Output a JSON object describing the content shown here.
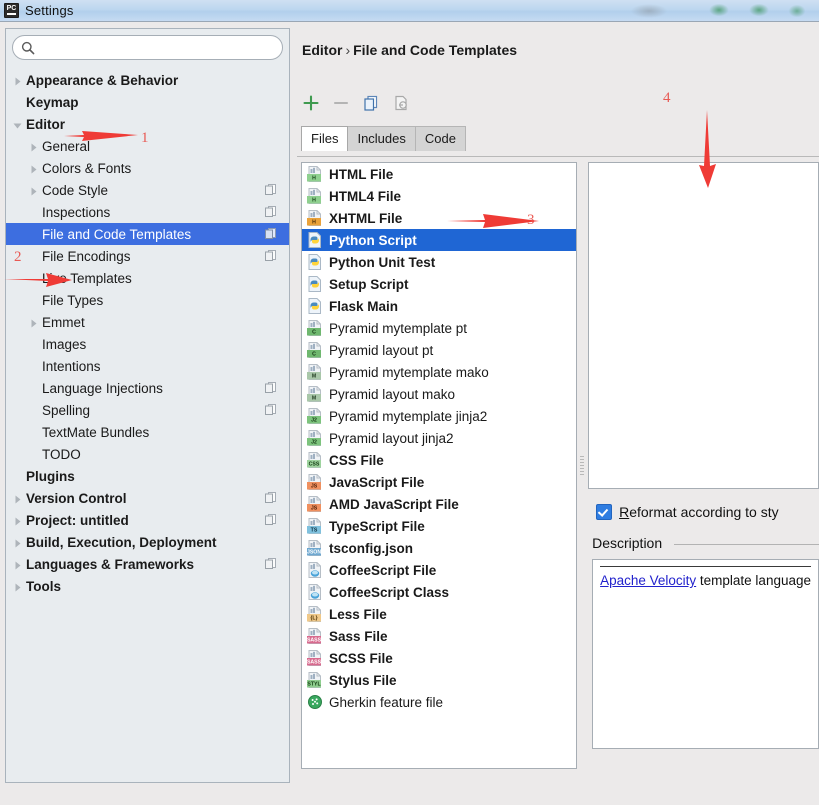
{
  "window": {
    "title": "Settings",
    "app_icon": "pycharm-icon"
  },
  "sidebar": {
    "search": {
      "value": "",
      "placeholder": "",
      "icon": "search-icon"
    },
    "items": [
      {
        "label": "Appearance & Behavior",
        "level": 0,
        "bold": true,
        "twisty": "collapsed",
        "scope_icon": false,
        "selected": false
      },
      {
        "label": "Keymap",
        "level": 0,
        "bold": true,
        "twisty": "none",
        "scope_icon": false,
        "selected": false
      },
      {
        "label": "Editor",
        "level": 0,
        "bold": true,
        "twisty": "expanded",
        "scope_icon": false,
        "selected": false
      },
      {
        "label": "General",
        "level": 1,
        "bold": false,
        "twisty": "collapsed",
        "scope_icon": false,
        "selected": false
      },
      {
        "label": "Colors & Fonts",
        "level": 1,
        "bold": false,
        "twisty": "collapsed",
        "scope_icon": false,
        "selected": false
      },
      {
        "label": "Code Style",
        "level": 1,
        "bold": false,
        "twisty": "collapsed",
        "scope_icon": true,
        "selected": false
      },
      {
        "label": "Inspections",
        "level": 1,
        "bold": false,
        "twisty": "none",
        "scope_icon": true,
        "selected": false
      },
      {
        "label": "File and Code Templates",
        "level": 1,
        "bold": false,
        "twisty": "none",
        "scope_icon": true,
        "selected": true
      },
      {
        "label": "File Encodings",
        "level": 1,
        "bold": false,
        "twisty": "none",
        "scope_icon": true,
        "selected": false
      },
      {
        "label": "Live Templates",
        "level": 1,
        "bold": false,
        "twisty": "none",
        "scope_icon": false,
        "selected": false
      },
      {
        "label": "File Types",
        "level": 1,
        "bold": false,
        "twisty": "none",
        "scope_icon": false,
        "selected": false
      },
      {
        "label": "Emmet",
        "level": 1,
        "bold": false,
        "twisty": "collapsed",
        "scope_icon": false,
        "selected": false
      },
      {
        "label": "Images",
        "level": 1,
        "bold": false,
        "twisty": "none",
        "scope_icon": false,
        "selected": false
      },
      {
        "label": "Intentions",
        "level": 1,
        "bold": false,
        "twisty": "none",
        "scope_icon": false,
        "selected": false
      },
      {
        "label": "Language Injections",
        "level": 1,
        "bold": false,
        "twisty": "none",
        "scope_icon": true,
        "selected": false
      },
      {
        "label": "Spelling",
        "level": 1,
        "bold": false,
        "twisty": "none",
        "scope_icon": true,
        "selected": false
      },
      {
        "label": "TextMate Bundles",
        "level": 1,
        "bold": false,
        "twisty": "none",
        "scope_icon": false,
        "selected": false
      },
      {
        "label": "TODO",
        "level": 1,
        "bold": false,
        "twisty": "none",
        "scope_icon": false,
        "selected": false
      },
      {
        "label": "Plugins",
        "level": 0,
        "bold": true,
        "twisty": "none",
        "scope_icon": false,
        "selected": false
      },
      {
        "label": "Version Control",
        "level": 0,
        "bold": true,
        "twisty": "collapsed",
        "scope_icon": true,
        "selected": false
      },
      {
        "label": "Project: untitled",
        "level": 0,
        "bold": true,
        "twisty": "collapsed",
        "scope_icon": true,
        "selected": false
      },
      {
        "label": "Build, Execution, Deployment",
        "level": 0,
        "bold": true,
        "twisty": "collapsed",
        "scope_icon": false,
        "selected": false
      },
      {
        "label": "Languages & Frameworks",
        "level": 0,
        "bold": true,
        "twisty": "collapsed",
        "scope_icon": true,
        "selected": false
      },
      {
        "label": "Tools",
        "level": 0,
        "bold": true,
        "twisty": "collapsed",
        "scope_icon": false,
        "selected": false
      }
    ]
  },
  "content": {
    "breadcrumb": {
      "parent": "Editor",
      "separator": "›",
      "current": "File and Code Templates"
    },
    "toolbar": [
      {
        "name": "add-template-button",
        "icon": "plus-icon",
        "label": "+",
        "enabled": true
      },
      {
        "name": "remove-template-button",
        "icon": "minus-icon",
        "label": "−",
        "enabled": false
      },
      {
        "name": "copy-template-button",
        "icon": "copy-icon",
        "label": "",
        "enabled": true
      },
      {
        "name": "export-template-button",
        "icon": "export-icon",
        "label": "",
        "enabled": false
      }
    ],
    "tabs": [
      {
        "label": "Files",
        "active": true
      },
      {
        "label": "Includes",
        "active": false
      },
      {
        "label": "Code",
        "active": false
      }
    ],
    "templates": [
      {
        "label": "HTML File",
        "icon": "html-file-icon",
        "bold": true,
        "selected": false
      },
      {
        "label": "HTML4 File",
        "icon": "html-file-icon",
        "bold": true,
        "selected": false
      },
      {
        "label": "XHTML File",
        "icon": "xhtml-file-icon",
        "bold": true,
        "selected": false
      },
      {
        "label": "Python Script",
        "icon": "python-file-icon",
        "bold": true,
        "selected": true
      },
      {
        "label": "Python Unit Test",
        "icon": "python-file-icon",
        "bold": true,
        "selected": false
      },
      {
        "label": "Setup Script",
        "icon": "python-file-icon",
        "bold": true,
        "selected": false
      },
      {
        "label": "Flask Main",
        "icon": "python-file-icon",
        "bold": true,
        "selected": false
      },
      {
        "label": "Pyramid mytemplate pt",
        "icon": "chameleon-file-icon",
        "bold": false,
        "selected": false
      },
      {
        "label": "Pyramid layout pt",
        "icon": "chameleon-file-icon",
        "bold": false,
        "selected": false
      },
      {
        "label": "Pyramid mytemplate mako",
        "icon": "mako-file-icon",
        "bold": false,
        "selected": false
      },
      {
        "label": "Pyramid layout mako",
        "icon": "mako-file-icon",
        "bold": false,
        "selected": false
      },
      {
        "label": "Pyramid mytemplate jinja2",
        "icon": "jinja2-file-icon",
        "bold": false,
        "selected": false
      },
      {
        "label": "Pyramid layout jinja2",
        "icon": "jinja2-file-icon",
        "bold": false,
        "selected": false
      },
      {
        "label": "CSS File",
        "icon": "css-file-icon",
        "bold": true,
        "selected": false
      },
      {
        "label": "JavaScript File",
        "icon": "javascript-file-icon",
        "bold": true,
        "selected": false
      },
      {
        "label": "AMD JavaScript File",
        "icon": "javascript-file-icon",
        "bold": true,
        "selected": false
      },
      {
        "label": "TypeScript File",
        "icon": "typescript-file-icon",
        "bold": true,
        "selected": false
      },
      {
        "label": "tsconfig.json",
        "icon": "json-file-icon",
        "bold": true,
        "selected": false
      },
      {
        "label": "CoffeeScript File",
        "icon": "coffeescript-file-icon",
        "bold": true,
        "selected": false
      },
      {
        "label": "CoffeeScript Class",
        "icon": "coffeescript-file-icon",
        "bold": true,
        "selected": false
      },
      {
        "label": "Less File",
        "icon": "less-file-icon",
        "bold": true,
        "selected": false
      },
      {
        "label": "Sass File",
        "icon": "sass-file-icon",
        "bold": true,
        "selected": false
      },
      {
        "label": "SCSS File",
        "icon": "scss-file-icon",
        "bold": true,
        "selected": false
      },
      {
        "label": "Stylus File",
        "icon": "stylus-file-icon",
        "bold": true,
        "selected": false
      },
      {
        "label": "Gherkin feature file",
        "icon": "gherkin-file-icon",
        "bold": false,
        "selected": false
      }
    ],
    "editor": {
      "value": ""
    },
    "reformat_checkbox": {
      "label_prefix": "R",
      "label_rest": "eformat according to sty",
      "checked": true
    },
    "description": {
      "group_label": "Description",
      "link_text": "Apache Velocity",
      "rest_text": " template language"
    }
  },
  "annotations": [
    {
      "number": "1",
      "target": "editor-sidebar-item"
    },
    {
      "number": "2",
      "target": "file-and-code-templates-sidebar-item"
    },
    {
      "number": "3",
      "target": "python-script-list-item"
    },
    {
      "number": "4",
      "target": "template-editor-area"
    }
  ],
  "colors": {
    "tree_selection": "#3d6ee0",
    "list_selection": "#1f66d4",
    "annotation_red": "#e8413a",
    "link_blue": "#2222cc",
    "checkbox_blue": "#2f7de1"
  }
}
